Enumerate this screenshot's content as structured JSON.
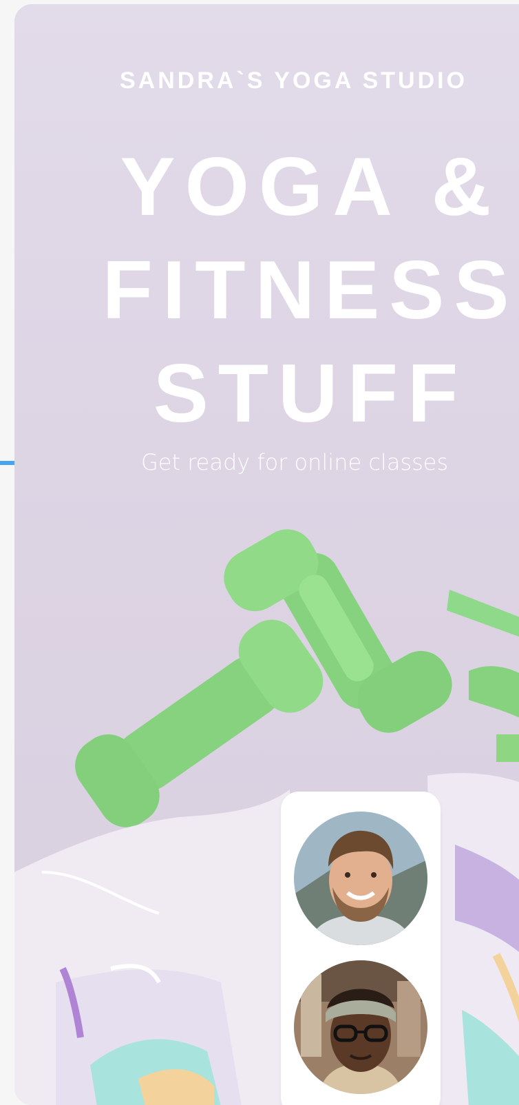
{
  "studio": {
    "name": "SANDRA`S YOGA STUDIO"
  },
  "headline": {
    "line1": "YOGA &",
    "line2": "FITNESS",
    "line3": "STUFF"
  },
  "subtitle": "Get ready for online classes",
  "images": {
    "scene": "dumbbells-and-sneakers-photo",
    "participant_1": "smiling-bearded-man-avatar",
    "participant_2": "woman-with-glasses-headband-avatar"
  },
  "colors": {
    "background": "#ddd5e4",
    "text": "#ffffff",
    "accent_line": "#4aa3ee",
    "dumbbell": "#8ed682"
  }
}
